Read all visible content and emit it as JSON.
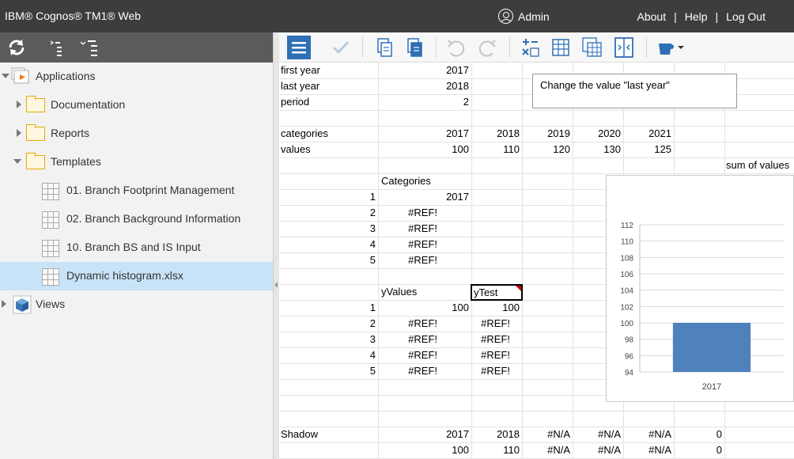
{
  "topbar": {
    "brand": "IBM® Cognos® TM1® Web",
    "user": "Admin",
    "links": [
      "About",
      "Help",
      "Log Out"
    ]
  },
  "tree": {
    "applications": "Applications",
    "documentation": "Documentation",
    "reports": "Reports",
    "templates": "Templates",
    "items": [
      "01. Branch Footprint Management",
      "02. Branch Background Information",
      "10. Branch BS and IS Input",
      "Dynamic histogram.xlsx"
    ],
    "views": "Views"
  },
  "sheet": {
    "first_year_label": "first year",
    "first_year_value": "2017",
    "last_year_label": "last year",
    "last_year_value": "2018",
    "period_label": "period",
    "period_value": "2",
    "note": "Change the value \"last year\"",
    "categories_label": "categories",
    "categories": [
      "2017",
      "2018",
      "2019",
      "2020",
      "2021"
    ],
    "values_label": "values",
    "values": [
      "100",
      "110",
      "120",
      "130",
      "125"
    ],
    "sum_label": "sum of values",
    "cat_header": "Categories",
    "idx": [
      "1",
      "2",
      "3",
      "4",
      "5"
    ],
    "cat_col": [
      "2017",
      "#REF!",
      "#REF!",
      "#REF!",
      "#REF!"
    ],
    "yvalues_header": "yValues",
    "ytest_header": "yTest",
    "yvalues_col": [
      "100",
      "#REF!",
      "#REF!",
      "#REF!",
      "#REF!"
    ],
    "ytest_col": [
      "100",
      "#REF!",
      "#REF!",
      "#REF!",
      "#REF!"
    ],
    "shadow_label": "Shadow",
    "shadow_row1": [
      "2017",
      "2018",
      "#N/A",
      "#N/A",
      "#N/A",
      "0"
    ],
    "shadow_row2": [
      "100",
      "110",
      "#N/A",
      "#N/A",
      "#N/A",
      "0"
    ]
  },
  "chart_data": {
    "type": "bar",
    "categories": [
      "2017"
    ],
    "values": [
      100
    ],
    "ylim": [
      94,
      112
    ],
    "yticks": [
      "94",
      "96",
      "98",
      "100",
      "102",
      "104",
      "106",
      "108",
      "110",
      "112"
    ],
    "bar_color": "#4f81bd",
    "grid": true
  }
}
